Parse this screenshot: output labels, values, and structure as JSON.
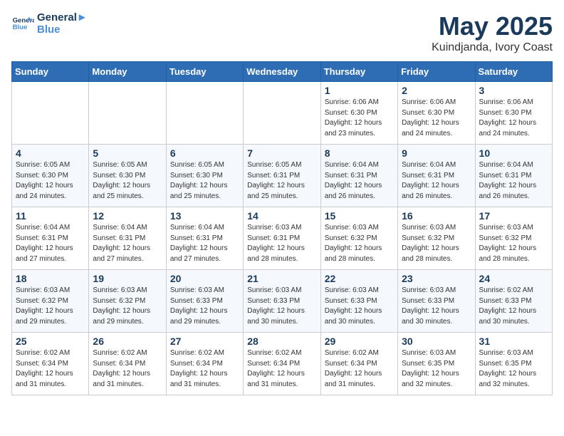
{
  "header": {
    "logo_line1": "General",
    "logo_line2": "Blue",
    "month": "May 2025",
    "location": "Kuindjanda, Ivory Coast"
  },
  "weekdays": [
    "Sunday",
    "Monday",
    "Tuesday",
    "Wednesday",
    "Thursday",
    "Friday",
    "Saturday"
  ],
  "weeks": [
    [
      {
        "day": "",
        "info": ""
      },
      {
        "day": "",
        "info": ""
      },
      {
        "day": "",
        "info": ""
      },
      {
        "day": "",
        "info": ""
      },
      {
        "day": "1",
        "info": "Sunrise: 6:06 AM\nSunset: 6:30 PM\nDaylight: 12 hours\nand 23 minutes."
      },
      {
        "day": "2",
        "info": "Sunrise: 6:06 AM\nSunset: 6:30 PM\nDaylight: 12 hours\nand 24 minutes."
      },
      {
        "day": "3",
        "info": "Sunrise: 6:06 AM\nSunset: 6:30 PM\nDaylight: 12 hours\nand 24 minutes."
      }
    ],
    [
      {
        "day": "4",
        "info": "Sunrise: 6:05 AM\nSunset: 6:30 PM\nDaylight: 12 hours\nand 24 minutes."
      },
      {
        "day": "5",
        "info": "Sunrise: 6:05 AM\nSunset: 6:30 PM\nDaylight: 12 hours\nand 25 minutes."
      },
      {
        "day": "6",
        "info": "Sunrise: 6:05 AM\nSunset: 6:30 PM\nDaylight: 12 hours\nand 25 minutes."
      },
      {
        "day": "7",
        "info": "Sunrise: 6:05 AM\nSunset: 6:31 PM\nDaylight: 12 hours\nand 25 minutes."
      },
      {
        "day": "8",
        "info": "Sunrise: 6:04 AM\nSunset: 6:31 PM\nDaylight: 12 hours\nand 26 minutes."
      },
      {
        "day": "9",
        "info": "Sunrise: 6:04 AM\nSunset: 6:31 PM\nDaylight: 12 hours\nand 26 minutes."
      },
      {
        "day": "10",
        "info": "Sunrise: 6:04 AM\nSunset: 6:31 PM\nDaylight: 12 hours\nand 26 minutes."
      }
    ],
    [
      {
        "day": "11",
        "info": "Sunrise: 6:04 AM\nSunset: 6:31 PM\nDaylight: 12 hours\nand 27 minutes."
      },
      {
        "day": "12",
        "info": "Sunrise: 6:04 AM\nSunset: 6:31 PM\nDaylight: 12 hours\nand 27 minutes."
      },
      {
        "day": "13",
        "info": "Sunrise: 6:04 AM\nSunset: 6:31 PM\nDaylight: 12 hours\nand 27 minutes."
      },
      {
        "day": "14",
        "info": "Sunrise: 6:03 AM\nSunset: 6:31 PM\nDaylight: 12 hours\nand 28 minutes."
      },
      {
        "day": "15",
        "info": "Sunrise: 6:03 AM\nSunset: 6:32 PM\nDaylight: 12 hours\nand 28 minutes."
      },
      {
        "day": "16",
        "info": "Sunrise: 6:03 AM\nSunset: 6:32 PM\nDaylight: 12 hours\nand 28 minutes."
      },
      {
        "day": "17",
        "info": "Sunrise: 6:03 AM\nSunset: 6:32 PM\nDaylight: 12 hours\nand 28 minutes."
      }
    ],
    [
      {
        "day": "18",
        "info": "Sunrise: 6:03 AM\nSunset: 6:32 PM\nDaylight: 12 hours\nand 29 minutes."
      },
      {
        "day": "19",
        "info": "Sunrise: 6:03 AM\nSunset: 6:32 PM\nDaylight: 12 hours\nand 29 minutes."
      },
      {
        "day": "20",
        "info": "Sunrise: 6:03 AM\nSunset: 6:33 PM\nDaylight: 12 hours\nand 29 minutes."
      },
      {
        "day": "21",
        "info": "Sunrise: 6:03 AM\nSunset: 6:33 PM\nDaylight: 12 hours\nand 30 minutes."
      },
      {
        "day": "22",
        "info": "Sunrise: 6:03 AM\nSunset: 6:33 PM\nDaylight: 12 hours\nand 30 minutes."
      },
      {
        "day": "23",
        "info": "Sunrise: 6:03 AM\nSunset: 6:33 PM\nDaylight: 12 hours\nand 30 minutes."
      },
      {
        "day": "24",
        "info": "Sunrise: 6:02 AM\nSunset: 6:33 PM\nDaylight: 12 hours\nand 30 minutes."
      }
    ],
    [
      {
        "day": "25",
        "info": "Sunrise: 6:02 AM\nSunset: 6:34 PM\nDaylight: 12 hours\nand 31 minutes."
      },
      {
        "day": "26",
        "info": "Sunrise: 6:02 AM\nSunset: 6:34 PM\nDaylight: 12 hours\nand 31 minutes."
      },
      {
        "day": "27",
        "info": "Sunrise: 6:02 AM\nSunset: 6:34 PM\nDaylight: 12 hours\nand 31 minutes."
      },
      {
        "day": "28",
        "info": "Sunrise: 6:02 AM\nSunset: 6:34 PM\nDaylight: 12 hours\nand 31 minutes."
      },
      {
        "day": "29",
        "info": "Sunrise: 6:02 AM\nSunset: 6:34 PM\nDaylight: 12 hours\nand 31 minutes."
      },
      {
        "day": "30",
        "info": "Sunrise: 6:03 AM\nSunset: 6:35 PM\nDaylight: 12 hours\nand 32 minutes."
      },
      {
        "day": "31",
        "info": "Sunrise: 6:03 AM\nSunset: 6:35 PM\nDaylight: 12 hours\nand 32 minutes."
      }
    ]
  ]
}
